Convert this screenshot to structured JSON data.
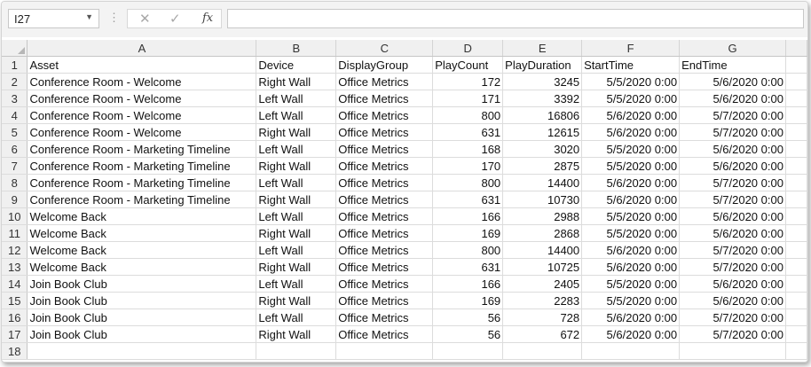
{
  "formula_bar": {
    "name_box": "I27",
    "cancel_icon": "✕",
    "enter_icon": "✓",
    "fx_label": "fx",
    "formula": ""
  },
  "columns": [
    "A",
    "B",
    "C",
    "D",
    "E",
    "F",
    "G"
  ],
  "row_numbers": [
    "1",
    "2",
    "3",
    "4",
    "5",
    "6",
    "7",
    "8",
    "9",
    "10",
    "11",
    "12",
    "13",
    "14",
    "15",
    "16",
    "17",
    "18"
  ],
  "header": [
    "Asset",
    "Device",
    "DisplayGroup",
    "PlayCount",
    "PlayDuration",
    "StartTime",
    "EndTime"
  ],
  "rows": [
    [
      "Conference Room - Welcome",
      "Right Wall",
      "Office Metrics",
      "172",
      "3245",
      "5/5/2020 0:00",
      "5/6/2020 0:00"
    ],
    [
      "Conference Room - Welcome",
      "Left Wall",
      "Office Metrics",
      "171",
      "3392",
      "5/5/2020 0:00",
      "5/6/2020 0:00"
    ],
    [
      "Conference Room - Welcome",
      "Left Wall",
      "Office Metrics",
      "800",
      "16806",
      "5/6/2020 0:00",
      "5/7/2020 0:00"
    ],
    [
      "Conference Room - Welcome",
      "Right Wall",
      "Office Metrics",
      "631",
      "12615",
      "5/6/2020 0:00",
      "5/7/2020 0:00"
    ],
    [
      "Conference Room - Marketing Timeline",
      "Left Wall",
      "Office Metrics",
      "168",
      "3020",
      "5/5/2020 0:00",
      "5/6/2020 0:00"
    ],
    [
      "Conference Room - Marketing Timeline",
      "Right Wall",
      "Office Metrics",
      "170",
      "2875",
      "5/5/2020 0:00",
      "5/6/2020 0:00"
    ],
    [
      "Conference Room - Marketing Timeline",
      "Left Wall",
      "Office Metrics",
      "800",
      "14400",
      "5/6/2020 0:00",
      "5/7/2020 0:00"
    ],
    [
      "Conference Room - Marketing Timeline",
      "Right Wall",
      "Office Metrics",
      "631",
      "10730",
      "5/6/2020 0:00",
      "5/7/2020 0:00"
    ],
    [
      "Welcome Back",
      "Left Wall",
      "Office Metrics",
      "166",
      "2988",
      "5/5/2020 0:00",
      "5/6/2020 0:00"
    ],
    [
      "Welcome Back",
      "Right Wall",
      "Office Metrics",
      "169",
      "2868",
      "5/5/2020 0:00",
      "5/6/2020 0:00"
    ],
    [
      "Welcome Back",
      "Left Wall",
      "Office Metrics",
      "800",
      "14400",
      "5/6/2020 0:00",
      "5/7/2020 0:00"
    ],
    [
      "Welcome Back",
      "Right Wall",
      "Office Metrics",
      "631",
      "10725",
      "5/6/2020 0:00",
      "5/7/2020 0:00"
    ],
    [
      "Join Book Club",
      "Left Wall",
      "Office Metrics",
      "166",
      "2405",
      "5/5/2020 0:00",
      "5/6/2020 0:00"
    ],
    [
      "Join Book Club",
      "Right Wall",
      "Office Metrics",
      "169",
      "2283",
      "5/5/2020 0:00",
      "5/6/2020 0:00"
    ],
    [
      "Join Book Club",
      "Left Wall",
      "Office Metrics",
      "56",
      "728",
      "5/6/2020 0:00",
      "5/7/2020 0:00"
    ],
    [
      "Join Book Club",
      "Right Wall",
      "Office Metrics",
      "56",
      "672",
      "5/6/2020 0:00",
      "5/7/2020 0:00"
    ],
    [
      "",
      "",
      "",
      "",
      "",
      "",
      ""
    ]
  ]
}
